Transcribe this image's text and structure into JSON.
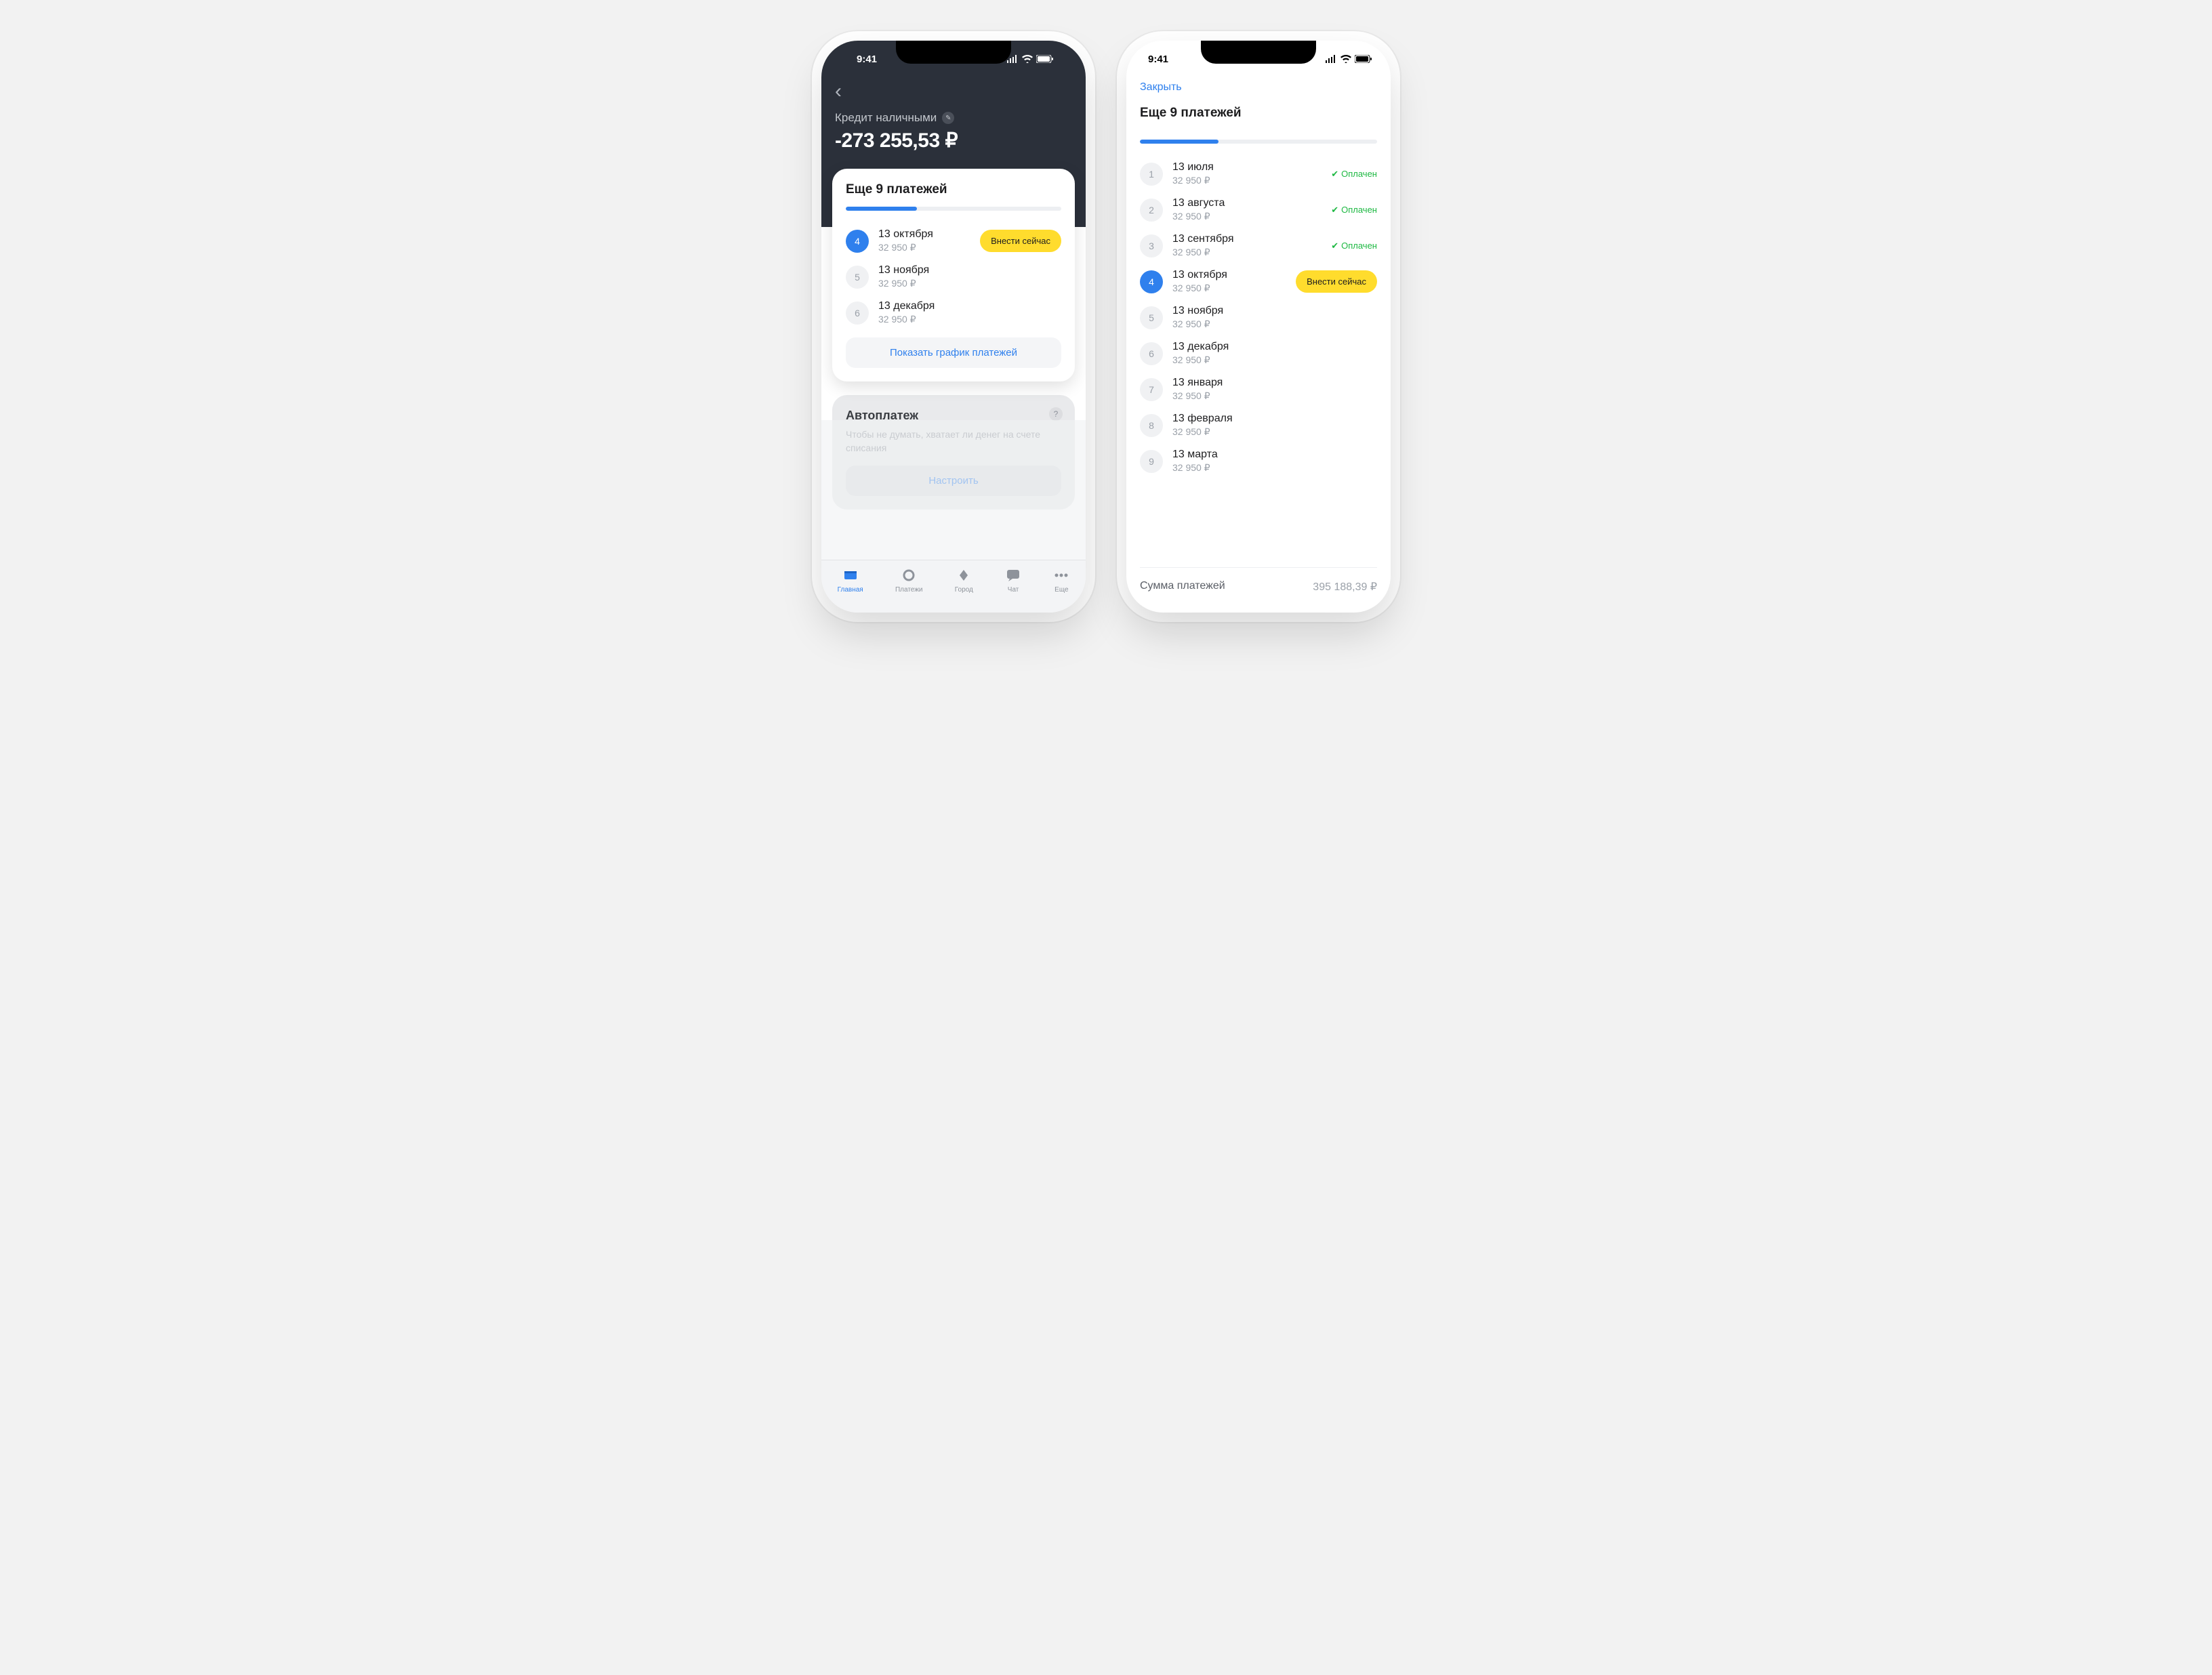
{
  "status_time": "9:41",
  "loan": {
    "title": "Кредит наличными",
    "balance": "-273 255,53 ₽"
  },
  "card": {
    "title": "Еще 9 платежей",
    "progress_percent": 33,
    "pay_now": "Внести сейчас",
    "show_all": "Показать график платежей"
  },
  "short_list": [
    {
      "num": "4",
      "date": "13 октября",
      "amount": "32 950 ₽",
      "active": true
    },
    {
      "num": "5",
      "date": "13 ноября",
      "amount": "32 950 ₽"
    },
    {
      "num": "6",
      "date": "13 декабря",
      "amount": "32 950 ₽"
    }
  ],
  "autopay": {
    "title": "Автоплатеж",
    "desc": "Чтобы не думать, хватает ли денег на счете списания",
    "button": "Настроить"
  },
  "tabs": {
    "home": "Главная",
    "payments": "Платежи",
    "city": "Город",
    "chat": "Чат",
    "more": "Еще"
  },
  "sheet": {
    "close": "Закрыть",
    "title": "Еще 9 платежей",
    "paid_label": "Оплачен",
    "list": [
      {
        "num": "1",
        "date": "13 июля",
        "amount": "32 950 ₽",
        "paid": true
      },
      {
        "num": "2",
        "date": "13 августа",
        "amount": "32 950 ₽",
        "paid": true
      },
      {
        "num": "3",
        "date": "13 сентября",
        "amount": "32 950 ₽",
        "paid": true
      },
      {
        "num": "4",
        "date": "13 октября",
        "amount": "32 950 ₽",
        "active": true
      },
      {
        "num": "5",
        "date": "13 ноября",
        "amount": "32 950 ₽"
      },
      {
        "num": "6",
        "date": "13 декабря",
        "amount": "32 950 ₽"
      },
      {
        "num": "7",
        "date": "13 января",
        "amount": "32 950 ₽"
      },
      {
        "num": "8",
        "date": "13 февраля",
        "amount": "32 950 ₽"
      },
      {
        "num": "9",
        "date": "13 марта",
        "amount": "32 950 ₽"
      }
    ],
    "footer_label": "Сумма платежей",
    "footer_value": "395 188,39 ₽"
  }
}
